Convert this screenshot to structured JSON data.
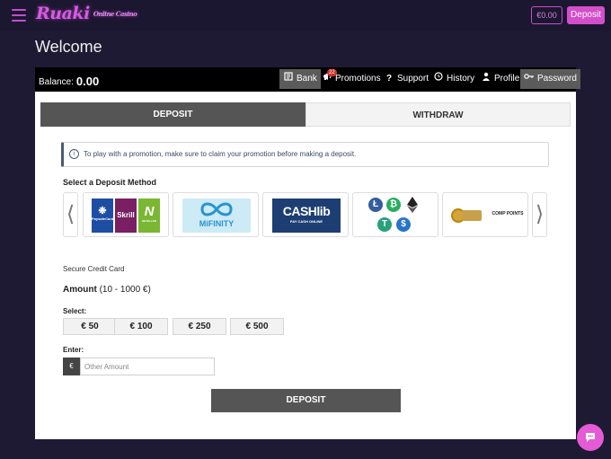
{
  "header": {
    "logo_text": "Ruaki",
    "logo_sub": "Online Casino",
    "balance_pill": "€0.00",
    "deposit_button": "Deposit"
  },
  "page": {
    "title": "Welcome"
  },
  "account_bar": {
    "balance_label": "Balance:",
    "balance_value": "0.00",
    "nav": [
      {
        "label": "Bank",
        "icon": "bank-icon",
        "active": true
      },
      {
        "label": "Promotions",
        "icon": "megaphone-icon",
        "badge": "22"
      },
      {
        "label": "Support",
        "icon": "question-icon"
      },
      {
        "label": "History",
        "icon": "history-icon"
      },
      {
        "label": "Profile",
        "icon": "user-icon"
      },
      {
        "label": "Password",
        "icon": "key-icon",
        "active": true
      }
    ]
  },
  "tabs": [
    {
      "label": "DEPOSIT",
      "active": true
    },
    {
      "label": "WITHDRAW",
      "active": false
    }
  ],
  "notice": {
    "text": "To play with a promotion, make sure to claim your promotion before making a deposit."
  },
  "methods": {
    "label": "Select a Deposit Method",
    "items": [
      {
        "name": "PaysafeCard Skrill Neteller",
        "logos": [
          "PaysafeCard",
          "Skrill",
          "N"
        ],
        "sub": "NETELLER"
      },
      {
        "name": "MiFinity",
        "text": "MiFINITY"
      },
      {
        "name": "CASHlib",
        "text": "CASHlib",
        "sub": "PAY CASH ONLINE"
      },
      {
        "name": "Crypto"
      },
      {
        "name": "Comp Points",
        "text": "COMP POINTS"
      }
    ]
  },
  "form": {
    "secure_label": "Secure Credit Card",
    "amount_label": "Amount",
    "amount_range": "(10 - 1000 €)",
    "select_label": "Select:",
    "amount_options": [
      "€ 50",
      "€ 100",
      "€ 250",
      "€ 500"
    ],
    "enter_label": "Enter:",
    "currency_prefix": "€",
    "amount_placeholder": "Other Amount",
    "submit_label": "DEPOSIT"
  },
  "colors": {
    "background": "#1f1a33",
    "accent": "#d44ec9",
    "dark_button": "#555555"
  }
}
